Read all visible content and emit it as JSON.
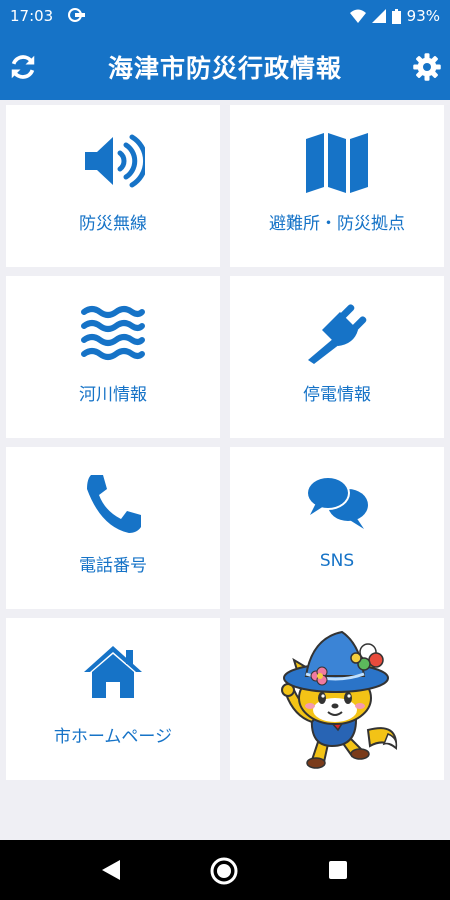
{
  "status_bar": {
    "time": "17:03",
    "battery": "93%"
  },
  "app_bar": {
    "title": "海津市防災行政情報"
  },
  "tiles": [
    {
      "label": "防災無線",
      "icon": "speaker-icon"
    },
    {
      "label": "避難所・防災拠点",
      "icon": "map-icon"
    },
    {
      "label": "河川情報",
      "icon": "water-waves-icon"
    },
    {
      "label": "停電情報",
      "icon": "plug-icon"
    },
    {
      "label": "電話番号",
      "icon": "phone-icon"
    },
    {
      "label": "SNS",
      "icon": "chat-bubbles-icon"
    },
    {
      "label": "市ホームページ",
      "icon": "home-icon"
    }
  ],
  "colors": {
    "primary": "#1673c7",
    "background": "#efeff4"
  }
}
